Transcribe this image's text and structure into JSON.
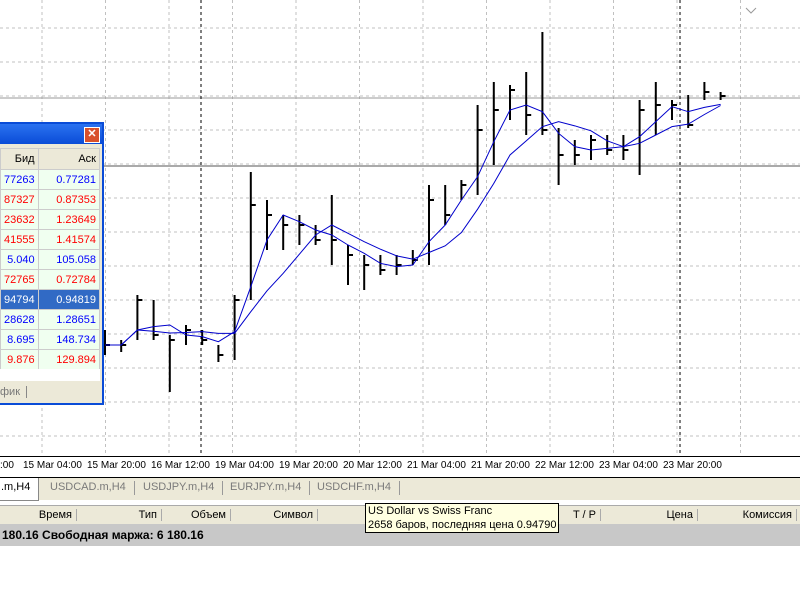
{
  "chart": {
    "symbol_desc": "US Dollar vs Swiss Franc",
    "bars_info": "2658 баров, последняя цена 0.94790",
    "colors": {
      "bars": "#000000",
      "ma": "#0000CC",
      "grid": "#C0C0C0"
    },
    "time_labels": [
      ":00",
      "15 Mar 04:00",
      "15 Mar 20:00",
      "16 Mar 12:00",
      "19 Mar 04:00",
      "19 Mar 20:00",
      "20 Mar 12:00",
      "21 Mar 04:00",
      "21 Mar 20:00",
      "22 Mar 12:00",
      "23 Mar 04:00",
      "23 Mar 20:00"
    ]
  },
  "chart_data": {
    "type": "ohlc",
    "series": [
      {
        "name": "USDCHF.m,H4",
        "high": [
          0.9245,
          0.9235,
          0.928,
          0.9275,
          0.924,
          0.925,
          0.9245,
          0.923,
          0.928,
          0.9403,
          0.9375,
          0.936,
          0.936,
          0.935,
          0.938,
          0.933,
          0.932,
          0.932,
          0.932,
          0.9325,
          0.939,
          0.939,
          0.9395,
          0.947,
          0.9493,
          0.949,
          0.9503,
          0.9543,
          0.9447,
          0.9435,
          0.944,
          0.944,
          0.944,
          0.9475,
          0.9493,
          0.9475,
          0.948,
          0.9493,
          0.9483
        ],
        "low": [
          0.922,
          0.9223,
          0.9235,
          0.9235,
          0.9183,
          0.923,
          0.923,
          0.9213,
          0.9215,
          0.9275,
          0.9325,
          0.9325,
          0.933,
          0.933,
          0.931,
          0.929,
          0.9285,
          0.93,
          0.93,
          0.931,
          0.931,
          0.935,
          0.9375,
          0.938,
          0.941,
          0.9455,
          0.944,
          0.944,
          0.939,
          0.941,
          0.9415,
          0.942,
          0.9415,
          0.94,
          0.944,
          0.9455,
          0.9447,
          0.9475,
          0.9475
        ],
        "close": [
          0.923,
          0.923,
          0.9275,
          0.924,
          0.9235,
          0.9245,
          0.9235,
          0.922,
          0.9275,
          0.937,
          0.936,
          0.935,
          0.935,
          0.9335,
          0.9335,
          0.932,
          0.931,
          0.9305,
          0.931,
          0.9315,
          0.9375,
          0.936,
          0.939,
          0.9445,
          0.9465,
          0.9485,
          0.946,
          0.9445,
          0.942,
          0.942,
          0.9435,
          0.9425,
          0.9425,
          0.9465,
          0.947,
          0.947,
          0.945,
          0.9483,
          0.9479
        ]
      }
    ],
    "ma_periods": [
      3,
      6
    ]
  },
  "market_watch": {
    "headers": {
      "bid": "Бид",
      "ask": "Аск"
    },
    "rows": [
      {
        "bid": "77263",
        "ask": "0.77281",
        "color": "#0000FF"
      },
      {
        "bid": "87327",
        "ask": "0.87353",
        "color": "#FF0000"
      },
      {
        "bid": "23632",
        "ask": "1.23649",
        "color": "#FF0000"
      },
      {
        "bid": "41555",
        "ask": "1.41574",
        "color": "#FF0000"
      },
      {
        "bid": "5.040",
        "ask": "105.058",
        "color": "#0000FF"
      },
      {
        "bid": "72765",
        "ask": "0.72784",
        "color": "#FF0000"
      },
      {
        "bid": "94794",
        "ask": "0.94819",
        "color": "#0000FF",
        "selected": true
      },
      {
        "bid": "28628",
        "ask": "1.28651",
        "color": "#0000FF"
      },
      {
        "bid": "8.695",
        "ask": "148.734",
        "color": "#0000FF"
      },
      {
        "bid": "9.876",
        "ask": "129.894",
        "color": "#FF0000"
      }
    ],
    "tab": "фик",
    "close_icon": "close-icon"
  },
  "tabs": [
    ".m,H4",
    "USDCAD.m,H4",
    "USDJPY.m,H4",
    "EURJPY.m,H4",
    "USDCHF.m,H4"
  ],
  "terminal_headers": [
    "Время",
    "Тип",
    "Объем",
    "Символ",
    "T / P",
    "Цена",
    "Комиссия"
  ],
  "status": "180.16  Свободная маржа: 6 180.16"
}
